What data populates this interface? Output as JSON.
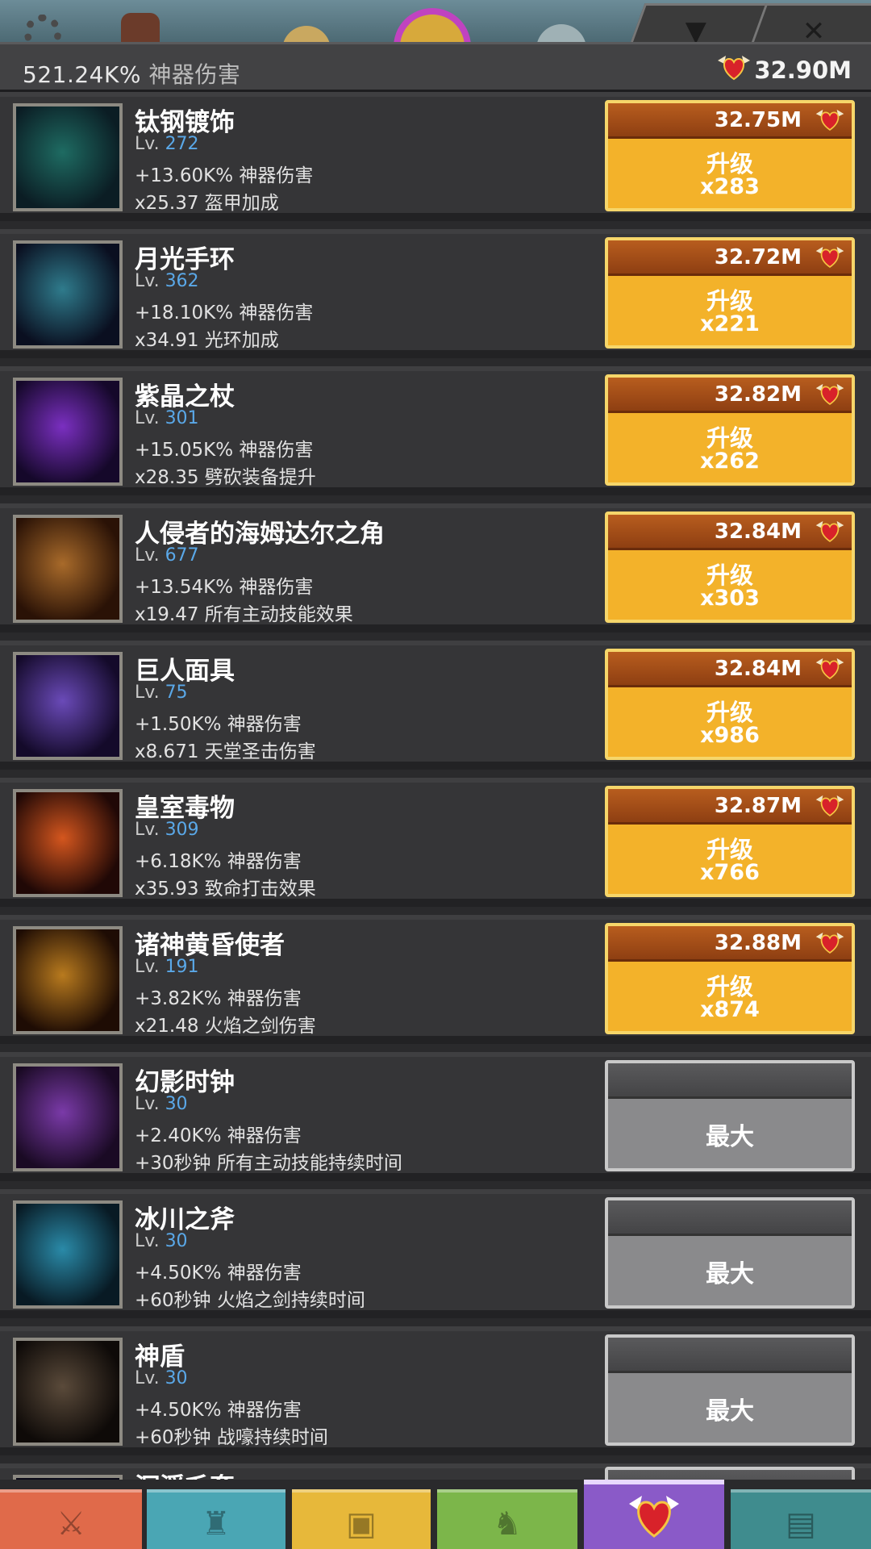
{
  "header": {
    "damage_value": "521.24K%",
    "damage_label": "神器伤害",
    "relic_total": "32.90M"
  },
  "upgrade_label": "升级",
  "lv_prefix": "Lv.",
  "artifacts": [
    {
      "name": "钛钢镀饰",
      "level": "272",
      "effect1": "+13.60K% 神器伤害",
      "effect2": "x25.37 盔甲加成",
      "cost": "32.75M",
      "multiplier": "x283",
      "icon": "titanium-plating-icon",
      "colors": [
        "#1e6b62",
        "#0b1d24"
      ]
    },
    {
      "name": "月光手环",
      "level": "362",
      "effect1": "+18.10K% 神器伤害",
      "effect2": "x34.91 光环加成",
      "cost": "32.72M",
      "multiplier": "x221",
      "icon": "moonlight-bracelet-icon",
      "colors": [
        "#2f7b8c",
        "#0a0f20"
      ]
    },
    {
      "name": "紫晶之杖",
      "level": "301",
      "effect1": "+15.05K% 神器伤害",
      "effect2": "x28.35 劈砍装备提升",
      "cost": "32.82M",
      "multiplier": "x262",
      "icon": "amethyst-staff-icon",
      "colors": [
        "#7a2fc0",
        "#15082a"
      ]
    },
    {
      "name": "人侵者的海姆达尔之角",
      "level": "677",
      "effect1": "+13.54K% 神器伤害",
      "effect2": "x19.47 所有主动技能效果",
      "cost": "32.84M",
      "multiplier": "x303",
      "icon": "invaders-gjallarhorn-icon",
      "colors": [
        "#a86a2a",
        "#2a1206"
      ]
    },
    {
      "name": "巨人面具",
      "level": "75",
      "effect1": "+1.50K% 神器伤害",
      "effect2": "x8.671 天堂圣击伤害",
      "cost": "32.84M",
      "multiplier": "x986",
      "icon": "titan-mask-icon",
      "colors": [
        "#6a4ab8",
        "#140a2a"
      ]
    },
    {
      "name": "皇室毒物",
      "level": "309",
      "effect1": "+6.18K% 神器伤害",
      "effect2": "x35.93 致命打击效果",
      "cost": "32.87M",
      "multiplier": "x766",
      "icon": "royal-toxin-icon",
      "colors": [
        "#d4561e",
        "#200806"
      ]
    },
    {
      "name": "诸神黄昏使者",
      "level": "191",
      "effect1": "+3.82K% 神器伤害",
      "effect2": "x21.48 火焰之剑伤害",
      "cost": "32.88M",
      "multiplier": "x874",
      "icon": "laborers-pendant-hammer-icon",
      "colors": [
        "#b87a1e",
        "#1e0c04"
      ]
    },
    {
      "name": "幻影时钟",
      "level": "30",
      "effect1": "+2.40K% 神器伤害",
      "effect2": "+30秒钟 所有主动技能持续时间",
      "max_label": "最大",
      "icon": "phantom-clock-icon",
      "colors": [
        "#7a3aa8",
        "#1a0a24"
      ]
    },
    {
      "name": "冰川之斧",
      "level": "30",
      "effect1": "+4.50K% 神器伤害",
      "effect2": "+60秒钟 火焰之剑持续时间",
      "max_label": "最大",
      "icon": "glacial-axe-icon",
      "colors": [
        "#2a8aa8",
        "#081a24"
      ]
    },
    {
      "name": "神盾",
      "level": "30",
      "effect1": "+4.50K% 神器伤害",
      "effect2": "+60秒钟 战嚎持续时间",
      "max_label": "最大",
      "icon": "aegis-shield-icon",
      "colors": [
        "#5a4a3a",
        "#0e0a08"
      ]
    }
  ],
  "peek_row_name": "沉浮毛套",
  "tabs": [
    {
      "name": "heroes",
      "icon": "sword-icon",
      "color": "#e06a4a"
    },
    {
      "name": "clan",
      "icon": "helmet-icon",
      "color": "#4aa6b4"
    },
    {
      "name": "equipment",
      "icon": "shirt-icon",
      "color": "#e7b83a"
    },
    {
      "name": "pets",
      "icon": "pet-icon",
      "color": "#7cb64a"
    },
    {
      "name": "artifacts",
      "icon": "winged-heart-icon",
      "color": "#8a5ac8"
    },
    {
      "name": "shop",
      "icon": "chest-icon",
      "color": "#3f8c8e"
    }
  ]
}
